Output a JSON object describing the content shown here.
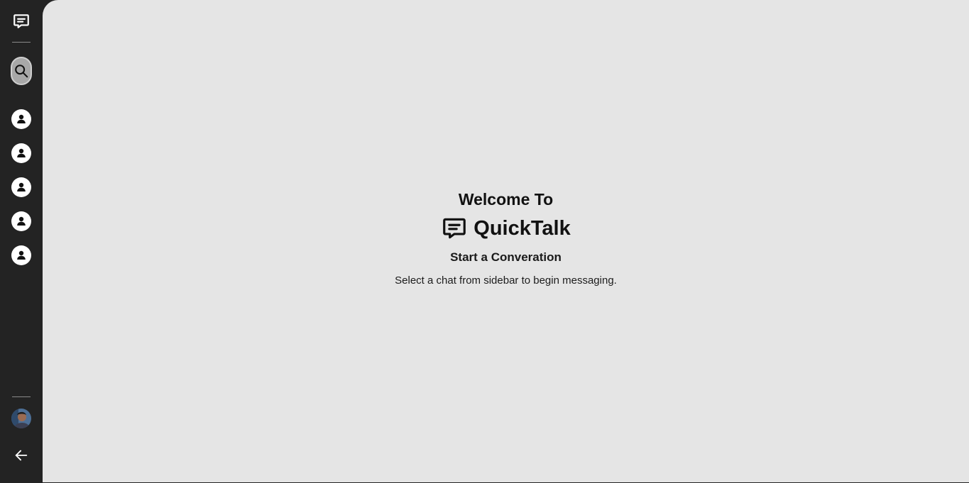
{
  "app": {
    "name": "QuickTalk"
  },
  "sidebar": {
    "logo_icon": "chat-bubble-icon",
    "search_icon": "search-icon",
    "contacts": [
      {
        "icon": "user-icon"
      },
      {
        "icon": "user-icon"
      },
      {
        "icon": "user-icon"
      },
      {
        "icon": "user-icon"
      },
      {
        "icon": "user-icon"
      }
    ],
    "profile_avatar": "avatar",
    "back_icon": "arrow-left-icon"
  },
  "main": {
    "welcome_title": "Welcome To",
    "brand_name": "QuickTalk",
    "subtitle": "Start a Converation",
    "instruction": "Select a chat from sidebar to begin messaging."
  },
  "colors": {
    "sidebar_bg": "#232323",
    "main_bg": "#e5e5e5",
    "text": "#111111",
    "search_bg": "#a8a8a8"
  }
}
